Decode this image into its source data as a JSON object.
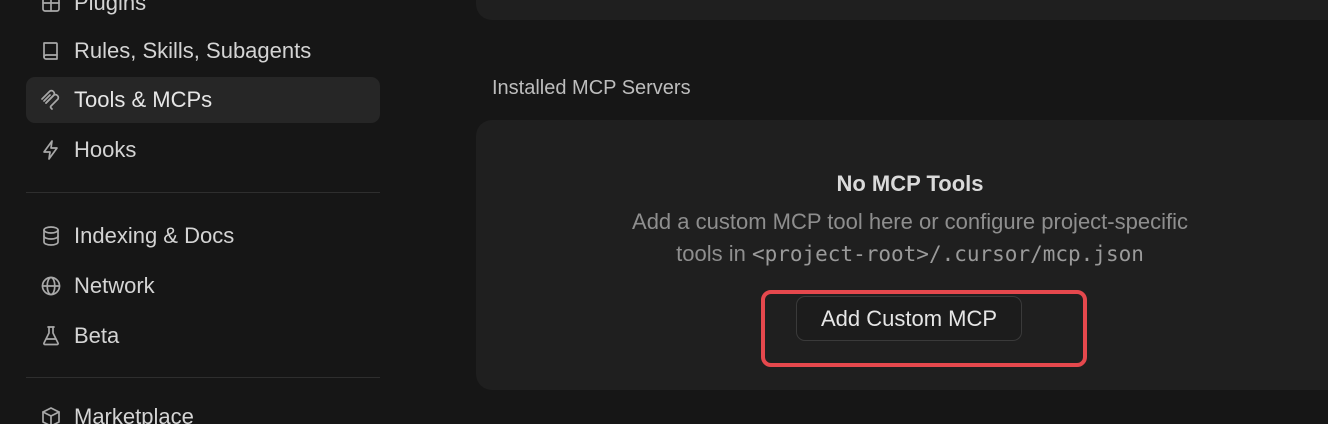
{
  "sidebar": {
    "items": [
      {
        "label": "Plugins",
        "icon": "puzzle-icon",
        "active": false
      },
      {
        "label": "Rules, Skills, Subagents",
        "icon": "book-icon",
        "active": false
      },
      {
        "label": "Tools & MCPs",
        "icon": "mcp-icon",
        "active": true
      },
      {
        "label": "Hooks",
        "icon": "lightning-icon",
        "active": false
      },
      {
        "label": "Indexing & Docs",
        "icon": "database-icon",
        "active": false
      },
      {
        "label": "Network",
        "icon": "globe-icon",
        "active": false
      },
      {
        "label": "Beta",
        "icon": "flask-icon",
        "active": false
      },
      {
        "label": "Marketplace",
        "icon": "package-icon",
        "active": false
      }
    ]
  },
  "main": {
    "installed_title": "Installed MCP Servers",
    "empty_state": {
      "title": "No MCP Tools",
      "line1": "Add a custom MCP tool here or configure project-specific",
      "line2_prefix": "tools in ",
      "line2_code": "<project-root>/.cursor/mcp.json"
    },
    "add_button_label": "Add Custom MCP"
  },
  "colors": {
    "background": "#161616",
    "card": "#1f1f1f",
    "active_item": "#262626",
    "highlight": "#e5484d"
  }
}
